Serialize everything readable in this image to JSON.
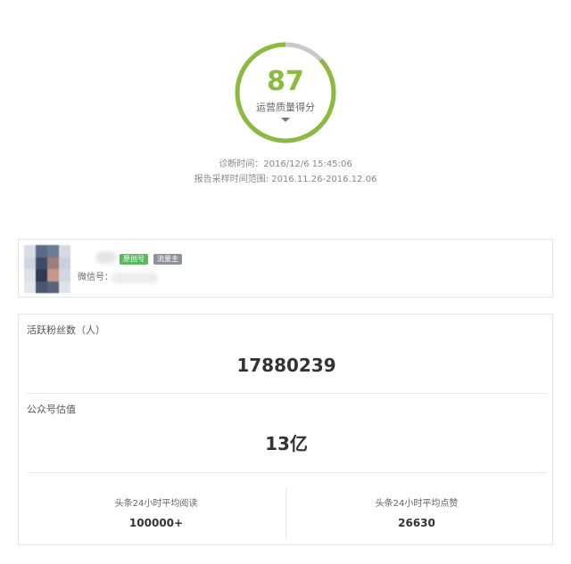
{
  "score": {
    "value": "87",
    "label": "运营质量得分",
    "fraction": 0.87,
    "colors": {
      "progress": "#8cba3f",
      "track": "#c8c8c8"
    }
  },
  "diagnosis": {
    "time": "诊断时间：2016/12/6 15:45:06",
    "range": "报告采样时间范围: 2016.11.26-2016.12.06"
  },
  "account": {
    "badges": {
      "original": "原创号",
      "traffic": "流量主"
    },
    "wechat_label": "微信号："
  },
  "stats": {
    "fans_label": "活跃粉丝数（人）",
    "fans_value": "17880239",
    "valuation_label": "公众号估值",
    "valuation_value": "13亿",
    "reads_label": "头条24小时平均阅读",
    "reads_value": "100000+",
    "likes_label": "头条24小时平均点赞",
    "likes_value": "26630"
  }
}
